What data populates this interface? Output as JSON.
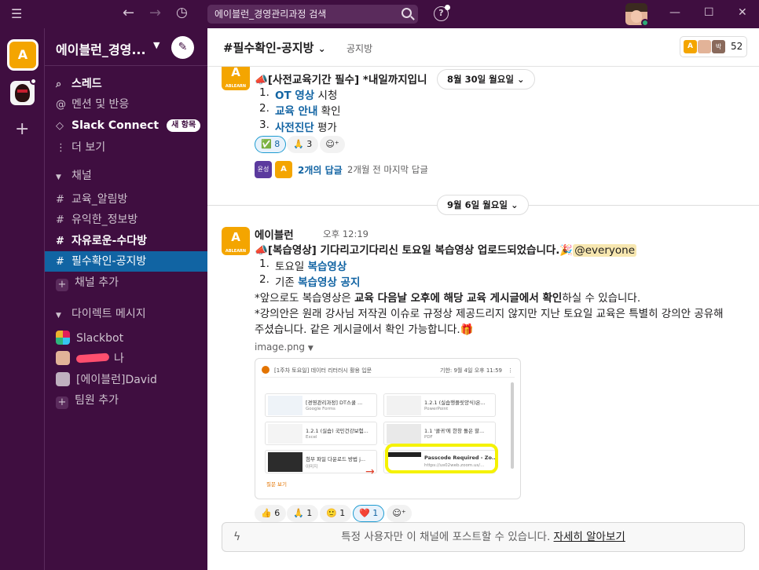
{
  "topbar": {
    "search_text": "에이블런_경영관리과정 검색",
    "menu_icon": "hamburger-icon",
    "back_icon": "arrow-left-icon",
    "forward_icon": "arrow-right-icon",
    "history_icon": "clock-icon",
    "help_icon": "question-icon"
  },
  "workspace": {
    "name": "에이블런_경영...",
    "logo_text": "A",
    "brand_sub": "ABLEARN"
  },
  "sidebar": {
    "items": [
      {
        "label": "스레드",
        "icon": "threads-icon"
      },
      {
        "label": "멘션 및 반응",
        "icon": "at-icon"
      },
      {
        "label": "Slack Connect",
        "icon": "connect-icon",
        "badge": "새 항목"
      },
      {
        "label": "더 보기",
        "icon": "more-vertical-icon"
      }
    ],
    "channels_header": "채널",
    "channels": [
      {
        "label": "교육_알림방"
      },
      {
        "label": "유익한_정보방"
      },
      {
        "label": "자유로운-수다방"
      },
      {
        "label": "필수확인-공지방"
      }
    ],
    "add_channel": "채널 추가",
    "dm_header": "다이렉트 메시지",
    "dms": [
      {
        "label": "Slackbot"
      },
      {
        "label": "나"
      },
      {
        "label": "[에이블런]David"
      }
    ],
    "add_member": "팀원 추가"
  },
  "channel": {
    "title": "#필수확인-공지방",
    "chevron": "⌄",
    "topic": "공지방",
    "member_count": "52",
    "member_initial": "박"
  },
  "messages": {
    "msg1": {
      "title_prefix": "[사전교육기간 필수] *내일까지입니",
      "list": [
        {
          "n": "1.",
          "link": "OT 영상",
          "rest": " 시청"
        },
        {
          "n": "2.",
          "link": "교육 안내",
          "rest": " 확인"
        },
        {
          "n": "3.",
          "link": "사전진단",
          "rest": " 평가"
        }
      ],
      "reactions": [
        {
          "emoji": "✅",
          "count": "8"
        },
        {
          "emoji": "🙏",
          "count": "3"
        }
      ],
      "thread_avatar_label": "윤성",
      "thread_replies": "2개의 답글",
      "thread_last": "2개월 전 마지막 답글"
    },
    "divider1": "8월 30일 월요일",
    "divider2": "9월 6일 월요일",
    "msg2": {
      "sender": "에이블런",
      "time": "오후 12:19",
      "headline": "[복습영상] 기다리고기다리신 토요일 복습영상 업로드되었습니다.",
      "mention": "@everyone",
      "list": [
        {
          "n": "1.",
          "pre": "토요일 ",
          "link": "복습영상"
        },
        {
          "n": "2.",
          "pre": "기존 ",
          "link": "복습영상 공지"
        }
      ],
      "line3_pre": "*앞으로도 복습영상은 ",
      "line3_bold": "교육 다음날 오후에 해당 교육 게시글에서 확인",
      "line3_post": "하실 수 있습니다.",
      "line4": "*강의안은 원래 강사님 저작권 이슈로 규정상 제공드리지 않지만 지난 토요일 교육은 특별히 강의안 공유해",
      "line5": "주셨습니다. 같은 게시글에서 확인 가능합니다.",
      "attachment_name": "image.png",
      "reactions": [
        {
          "emoji": "👍",
          "count": "6"
        },
        {
          "emoji": "🙏",
          "count": "1"
        },
        {
          "emoji": "🙂",
          "count": "1"
        },
        {
          "emoji": "❤️",
          "count": "1"
        }
      ]
    }
  },
  "image_preview": {
    "header_title": "[1주차 토요일] 데이터 리터러시 활용 입문",
    "header_meta": "기한: 9월 4일 오후 11:59",
    "cards": [
      {
        "title": "[경영관리과정] DT스쿨 ...",
        "sub": "Google Forms"
      },
      {
        "title": "1.2.1 (실습행플릿양식)온...",
        "sub": "PowerPoint"
      },
      {
        "title": "1.2.1 (실습) 국민건강보험...",
        "sub": "Excel"
      },
      {
        "title": "1.1 '콜귀'에 한창 돌은 할...",
        "sub": "PDF"
      },
      {
        "title": "첨부 파일 다운로드 방법 j...",
        "sub": "이미지"
      },
      {
        "title": "Passcode Required - Zo...",
        "sub": "https://us02web.zoom.us/..."
      }
    ],
    "footer_link": "질문 보기"
  },
  "composer": {
    "text": "특정 사용자만 이 채널에 포스트할 수 있습니다.",
    "link": "자세히 알아보기"
  },
  "colors": {
    "aubergine": "#3f0e40",
    "active": "#1164a3",
    "link": "#1264a3",
    "brand": "#f4a500",
    "highlight": "#f5f200"
  }
}
